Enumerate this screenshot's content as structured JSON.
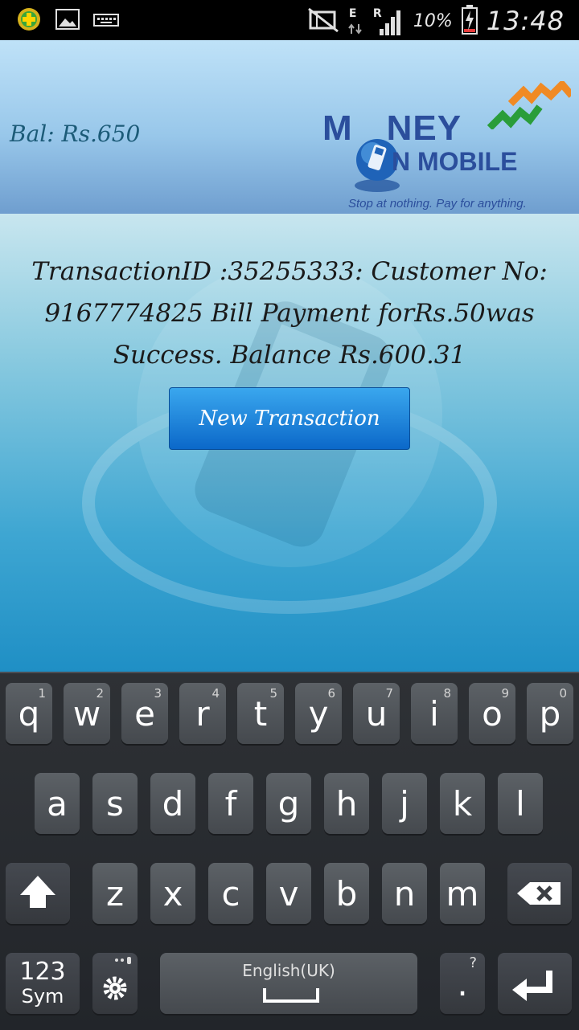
{
  "status_bar": {
    "network_e": "E",
    "network_r": "R",
    "battery_percent": "10%",
    "time": "13:48",
    "icons": [
      "app-notification-icon",
      "image-icon",
      "keyboard-icon",
      "nfc-off-icon",
      "data-arrows-icon",
      "signal-icon",
      "battery-charging-icon"
    ]
  },
  "header": {
    "balance": "Bal: Rs.650",
    "logo": {
      "word1": "M",
      "word1_rest": "NEY",
      "word2": "N MOBILE",
      "tagline": "Stop at nothing. Pay for anything.",
      "brand_color": "#2b4e9c",
      "arrow_colors": [
        "#f08a24",
        "#2a9d3a"
      ]
    }
  },
  "main": {
    "message_lines": [
      "TransactionID :35255333:  Customer No:",
      "9167774825  Bill Payment  forRs.50was",
      "Success. Balance Rs.600.31"
    ],
    "new_transaction_label": "New Transaction"
  },
  "keyboard": {
    "row1": [
      {
        "char": "q",
        "num": "1"
      },
      {
        "char": "w",
        "num": "2"
      },
      {
        "char": "e",
        "num": "3"
      },
      {
        "char": "r",
        "num": "4"
      },
      {
        "char": "t",
        "num": "5"
      },
      {
        "char": "y",
        "num": "6"
      },
      {
        "char": "u",
        "num": "7"
      },
      {
        "char": "i",
        "num": "8"
      },
      {
        "char": "o",
        "num": "9"
      },
      {
        "char": "p",
        "num": "0"
      }
    ],
    "row2": [
      "a",
      "s",
      "d",
      "f",
      "g",
      "h",
      "j",
      "k",
      "l"
    ],
    "row3": [
      "z",
      "x",
      "c",
      "v",
      "b",
      "n",
      "m"
    ],
    "sym_line1": "123",
    "sym_line2": "Sym",
    "space_language": "English(UK)",
    "period": ".",
    "period_hint": "?"
  }
}
